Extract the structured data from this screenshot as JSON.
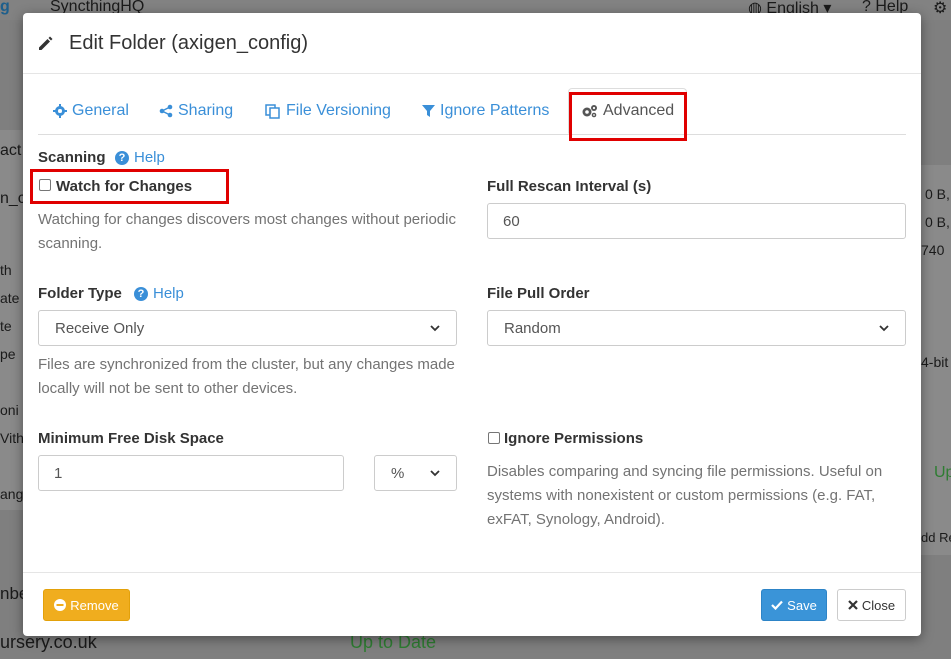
{
  "background": {
    "app_name": "SyncthingHQ",
    "language": "English",
    "help": "Help",
    "fragments_left": [
      "act",
      "n_c",
      "th",
      "ate",
      "te",
      "pe",
      "oni",
      "Vith",
      "ang",
      "nbe",
      "ursery.co.uk"
    ],
    "fragments_right": [
      "0 B,",
      "0 B,",
      "740",
      "4-bit",
      "Up",
      "dd Re"
    ],
    "status_up_to_date": "Up to Date"
  },
  "modal": {
    "title": "Edit Folder (axigen_config)",
    "tabs": [
      {
        "label": "General",
        "icon": "gear-icon"
      },
      {
        "label": "Sharing",
        "icon": "share-icon"
      },
      {
        "label": "File Versioning",
        "icon": "copy-icon"
      },
      {
        "label": "Ignore Patterns",
        "icon": "filter-icon"
      },
      {
        "label": "Advanced",
        "icon": "gears-icon",
        "active": true
      }
    ],
    "scanning": {
      "label": "Scanning",
      "help": "Help",
      "watch_label": "Watch for Changes",
      "watch_checked": false,
      "watch_desc": "Watching for changes discovers most changes without periodic scanning."
    },
    "full_rescan": {
      "label": "Full Rescan Interval (s)",
      "value": "60"
    },
    "folder_type": {
      "label": "Folder Type",
      "help": "Help",
      "value": "Receive Only",
      "desc": "Files are synchronized from the cluster, but any changes made locally will not be sent to other devices."
    },
    "pull_order": {
      "label": "File Pull Order",
      "value": "Random"
    },
    "min_disk": {
      "label": "Minimum Free Disk Space",
      "value": "1",
      "unit": "%"
    },
    "ignore_perms": {
      "label": "Ignore Permissions",
      "checked": false,
      "desc": "Disables comparing and syncing file permissions. Useful on systems with nonexistent or custom permissions (e.g. FAT, exFAT, Synology, Android)."
    },
    "footer": {
      "remove": "Remove",
      "save": "Save",
      "close": "Close"
    }
  }
}
